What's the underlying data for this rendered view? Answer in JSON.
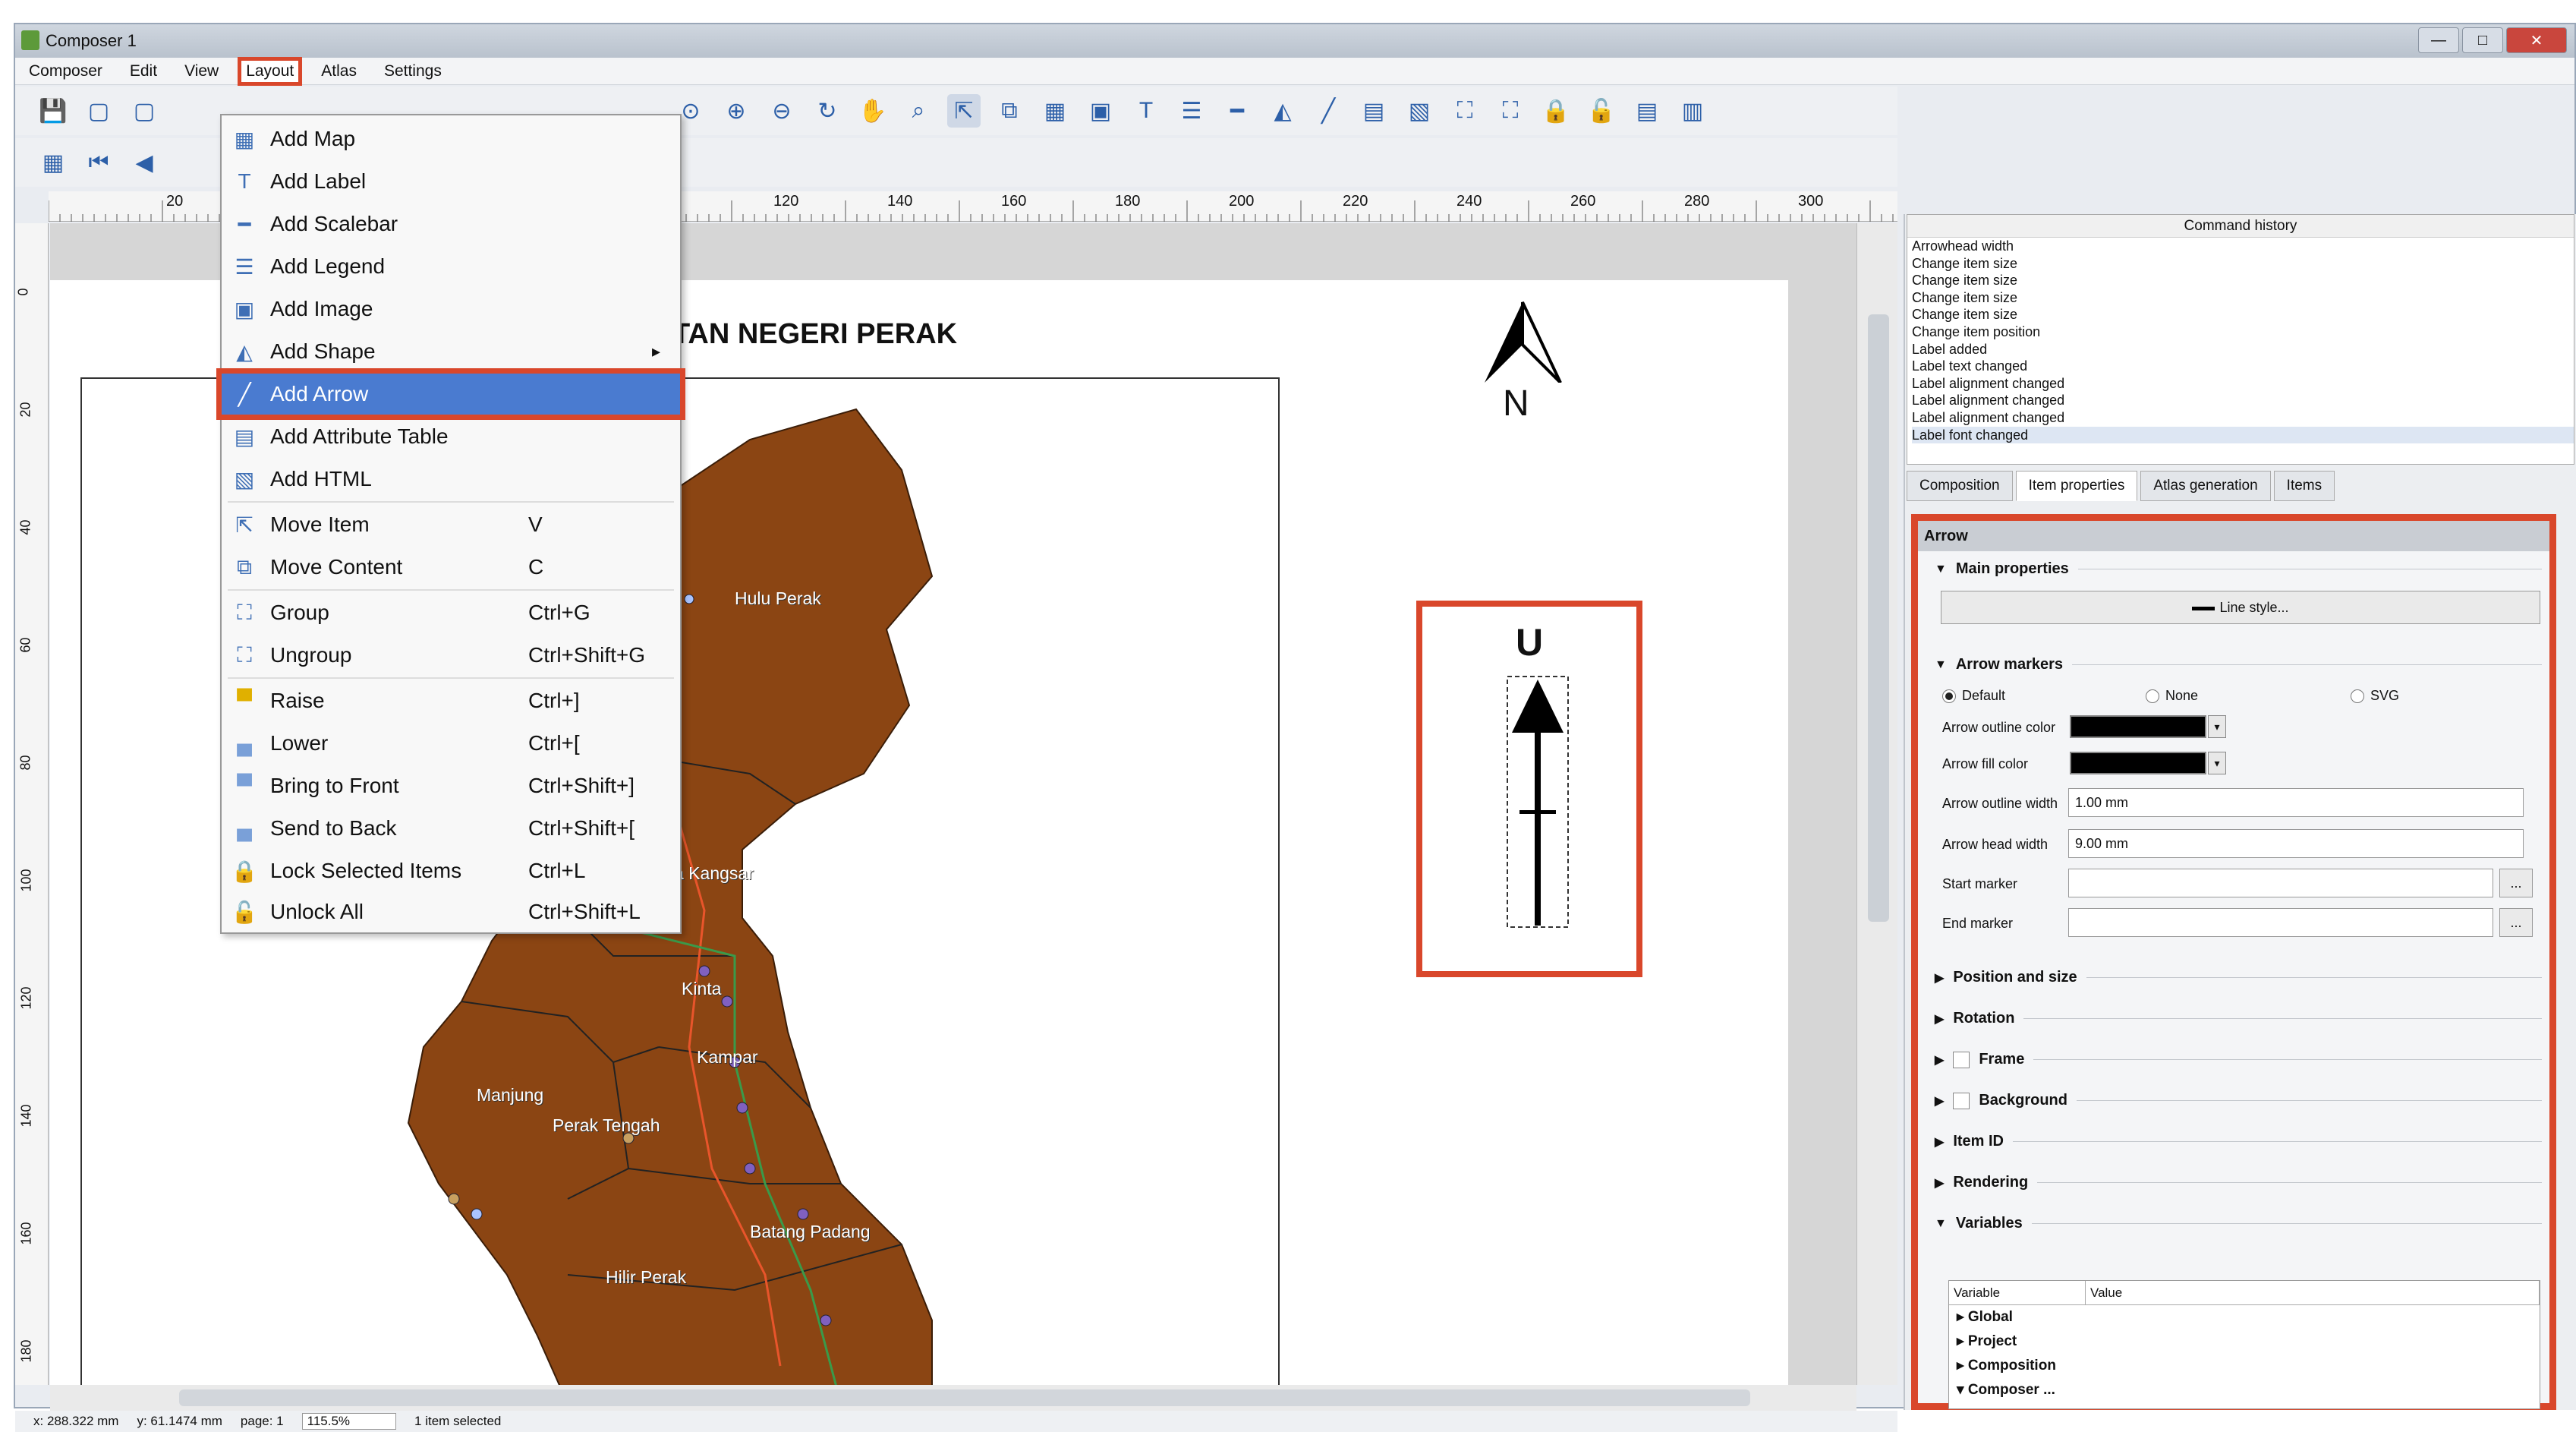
{
  "window": {
    "title": "Composer 1",
    "controls": [
      "—",
      "□",
      "✕"
    ]
  },
  "menubar": [
    "Composer",
    "Edit",
    "View",
    "Layout",
    "Atlas",
    "Settings"
  ],
  "layout_menu": [
    {
      "label": "Add Map",
      "shortcut": "",
      "icon": "add-map-icon"
    },
    {
      "label": "Add Label",
      "shortcut": "",
      "icon": "add-label-icon"
    },
    {
      "label": "Add Scalebar",
      "shortcut": "",
      "icon": "add-scalebar-icon"
    },
    {
      "label": "Add Legend",
      "shortcut": "",
      "icon": "add-legend-icon"
    },
    {
      "label": "Add Image",
      "shortcut": "",
      "icon": "add-image-icon"
    },
    {
      "label": "Add Shape",
      "shortcut": "",
      "icon": "add-shape-icon",
      "submenu": "▸"
    },
    {
      "label": "Add Arrow",
      "shortcut": "",
      "icon": "add-arrow-icon"
    },
    {
      "label": "Add Attribute Table",
      "shortcut": "",
      "icon": "add-attribute-table-icon"
    },
    {
      "label": "Add HTML",
      "shortcut": "",
      "icon": "add-html-icon"
    },
    {
      "label": "Move Item",
      "shortcut": "V",
      "icon": "move-item-icon"
    },
    {
      "label": "Move Content",
      "shortcut": "C",
      "icon": "move-content-icon"
    },
    {
      "label": "Group",
      "shortcut": "Ctrl+G",
      "icon": "group-icon"
    },
    {
      "label": "Ungroup",
      "shortcut": "Ctrl+Shift+G",
      "icon": "ungroup-icon"
    },
    {
      "label": "Raise",
      "shortcut": "Ctrl+]",
      "icon": "raise-icon"
    },
    {
      "label": "Lower",
      "shortcut": "Ctrl+[",
      "icon": "lower-icon"
    },
    {
      "label": "Bring to Front",
      "shortcut": "Ctrl+Shift+]",
      "icon": "bring-to-front-icon"
    },
    {
      "label": "Send to Back",
      "shortcut": "Ctrl+Shift+[",
      "icon": "send-to-back-icon"
    },
    {
      "label": "Lock Selected Items",
      "shortcut": "Ctrl+L",
      "icon": "lock-icon"
    },
    {
      "label": "Unlock All",
      "shortcut": "Ctrl+Shift+L",
      "icon": "unlock-icon"
    }
  ],
  "ruler_top": [
    "20",
    "120",
    "140",
    "160",
    "180",
    "200",
    "220",
    "240",
    "260",
    "280",
    "300"
  ],
  "ruler_left": [
    "0",
    "20",
    "40",
    "60",
    "80",
    "100",
    "120",
    "140",
    "160",
    "180"
  ],
  "map": {
    "title": "TAN NEGERI PERAK",
    "north_label": "N",
    "north_label_2": "U",
    "districts": [
      "Hulu Perak",
      "a Kangsar",
      "Kinta",
      "Kampar",
      "Manjung",
      "Perak Tengah",
      "Batang Padang",
      "Hilir Perak"
    ]
  },
  "command_history": {
    "title": "Command history",
    "entries": [
      "Arrowhead width",
      "Change item size",
      "Change item size",
      "Change item size",
      "Change item size",
      "Change item position",
      "Label added",
      "Label text changed",
      "Label alignment changed",
      "Label alignment changed",
      "Label alignment changed",
      "Label font changed"
    ]
  },
  "panel_tabs": [
    "Composition",
    "Item properties",
    "Atlas generation",
    "Items"
  ],
  "item_properties": {
    "title": "Arrow",
    "main_properties": "Main properties",
    "line_style_button": "Line style...",
    "arrow_markers": "Arrow markers",
    "radio_default": "Default",
    "radio_none": "None",
    "radio_svg": "SVG",
    "outline_color_label": "Arrow outline color",
    "fill_color_label": "Arrow fill color",
    "outline_width_label": "Arrow outline width",
    "outline_width_value": "1.00 mm",
    "head_width_label": "Arrow head width",
    "head_width_value": "9.00 mm",
    "start_marker_label": "Start marker",
    "end_marker_label": "End marker",
    "browse_label": "...",
    "sections": [
      "Position and size",
      "Rotation",
      "Frame",
      "Background",
      "Item ID",
      "Rendering",
      "Variables"
    ],
    "var_headers": [
      "Variable",
      "Value"
    ],
    "var_rows": [
      "Global",
      "Project",
      "Composition",
      "Composer ..."
    ]
  },
  "status": {
    "x": "x: 288.322 mm",
    "y": "y: 61.1474 mm",
    "page": "page: 1",
    "zoom": "115.5%",
    "selected": "1 item selected"
  },
  "colors": {
    "highlight": "#d9472b",
    "district_fill": "#8b4513",
    "menu_selected": "#4a7bd0"
  }
}
